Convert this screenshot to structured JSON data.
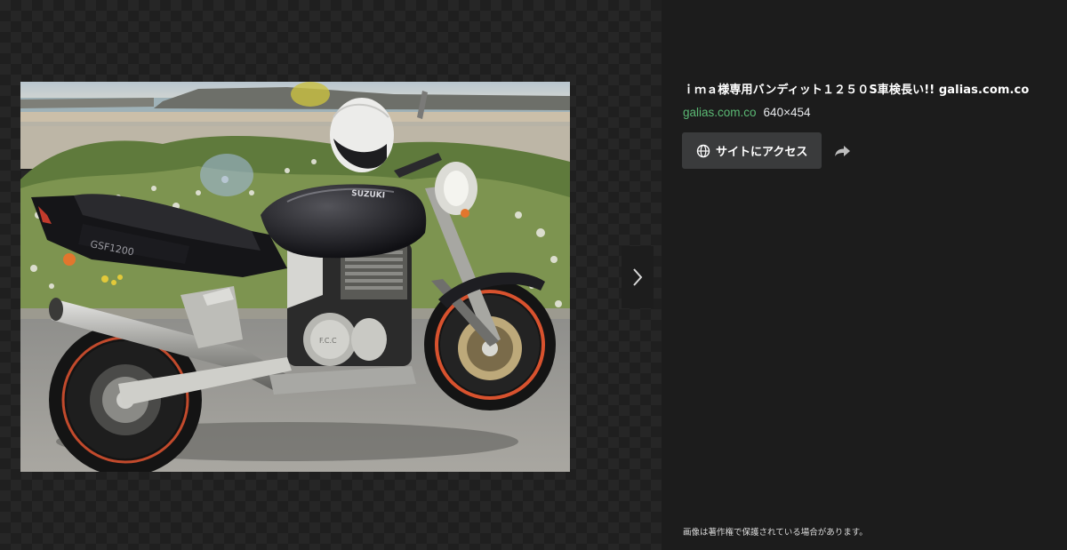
{
  "result": {
    "title": "ｉｍａ様専用バンディット１２５０S車検長い!! galias.com.co",
    "source": "galias.com.co",
    "dimensions": "640×454",
    "visit_label": "サイトにアクセス",
    "copyright_notice": "画像は著作権で保護されている場合があります。"
  },
  "photo": {
    "brand_tank": "SUZUKI",
    "side_cover": "GSF1200",
    "engine_cover": "F.C.C"
  },
  "icons": {
    "next": "chevron-right-icon",
    "visit": "globe-icon",
    "share": "share-arrow-icon"
  },
  "colors": {
    "source_link": "#5bb974",
    "panel_bg": "#1c1c1c",
    "button_bg": "#3a3b3c"
  }
}
